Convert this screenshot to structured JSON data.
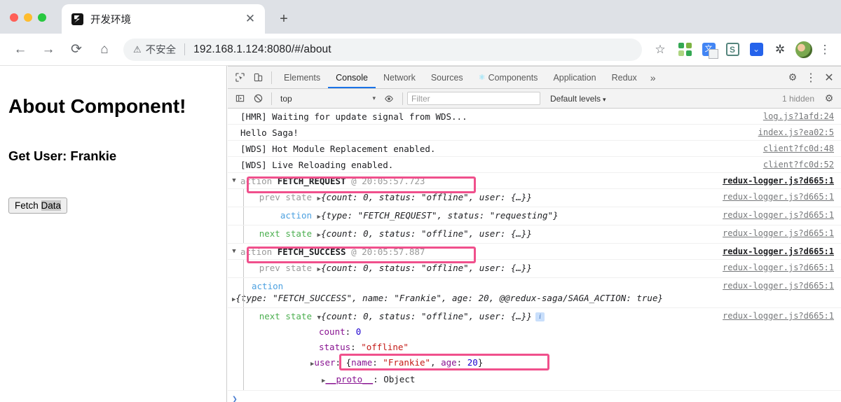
{
  "browser": {
    "tab": {
      "title": "开发环境",
      "close_label": "✕"
    },
    "new_tab_label": "+",
    "nav": {
      "back": "←",
      "forward": "→",
      "reload": "⟳",
      "home": "⌂"
    },
    "omnibox": {
      "security_icon": "warning-triangle-icon",
      "security_text": "不安全",
      "url": "192.168.1.124:8080/#/about"
    },
    "actions": {
      "bookmark": "☆",
      "ext_qr": "qr-code-icon",
      "ext_translate": "文",
      "ext_s": "S",
      "ext_blue": "⌄",
      "ext_puzzle": "✦",
      "avatar": "avatar-icon",
      "menu": "⋮"
    }
  },
  "page": {
    "heading": "About Component!",
    "subheading": "Get User: Frankie",
    "button_prefix": "Fetch ",
    "button_selected": "Data"
  },
  "devtools": {
    "inspect_icon": "inspect-element-icon",
    "device_icon": "device-toolbar-icon",
    "tabs": [
      {
        "label": "Elements",
        "active": false
      },
      {
        "label": "Console",
        "active": true
      },
      {
        "label": "Network",
        "active": false
      },
      {
        "label": "Sources",
        "active": false
      },
      {
        "label": "Components",
        "active": false,
        "react": true
      },
      {
        "label": "Application",
        "active": false
      },
      {
        "label": "Redux",
        "active": false
      }
    ],
    "more_tabs": "»",
    "settings_icon": "⚙",
    "kebab_icon": "⋮",
    "close_icon": "✕",
    "filterbar": {
      "sidebar_icon": "console-sidebar-icon",
      "clear_icon": "🚫",
      "context": "top",
      "context_caret": "▾",
      "eye_icon": "👁",
      "filter_placeholder": "Filter",
      "levels": "Default levels",
      "levels_caret": "▾",
      "hidden": "1 hidden",
      "gear_icon": "⚙"
    },
    "prompt_chevron": "❯"
  },
  "console_rows": [
    {
      "text": "[HMR] Waiting for update signal from WDS...",
      "src": "log.js?1afd:24"
    },
    {
      "text": "Hello Saga!",
      "src": "index.js?ea02:5"
    },
    {
      "text": "[WDS] Hot Module Replacement enabled.",
      "src": "client?fc0d:48"
    },
    {
      "text": "[WDS] Live Reloading enabled.",
      "src": "client?fc0d:52"
    }
  ],
  "groups": [
    {
      "triangle": "▼",
      "header": {
        "label": "action",
        "name": "FETCH_REQUEST",
        "at": "@",
        "time": "20:05:57.723"
      },
      "src": "redux-logger.js?d665:1",
      "rows": [
        {
          "label": "prev state",
          "label_kind": "prev",
          "triangle": "▶",
          "preview": "{count: 0, status: \"offline\", user: {…}}",
          "src": "redux-logger.js?d665:1"
        },
        {
          "label": "action",
          "label_kind": "action",
          "triangle": "▶",
          "preview": "{type: \"FETCH_REQUEST\", status: \"requesting\"}",
          "src": "redux-logger.js?d665:1"
        },
        {
          "label": "next state",
          "label_kind": "next",
          "triangle": "▶",
          "preview": "{count: 0, status: \"offline\", user: {…}}",
          "src": "redux-logger.js?d665:1"
        }
      ]
    },
    {
      "triangle": "▼",
      "header": {
        "label": "action",
        "name": "FETCH_SUCCESS",
        "at": "@",
        "time": "20:05:57.887"
      },
      "src": "redux-logger.js?d665:1",
      "rows": [
        {
          "label": "prev state",
          "label_kind": "prev",
          "triangle": "▶",
          "preview": "{count: 0, status: \"offline\", user: {…}}",
          "src": "redux-logger.js?d665:1"
        },
        {
          "label": "action",
          "label_kind": "action",
          "triangle": "▶",
          "preview": "{type: \"FETCH_SUCCESS\", name: \"Frankie\", age: 20, @@redux-saga/SAGA_ACTION: true}",
          "src": "redux-logger.js?d665:1",
          "wrapped": true
        },
        {
          "label": "next state",
          "label_kind": "next",
          "triangle": "▼",
          "preview": "{count: 0, status: \"offline\", user: {…}}",
          "src": "redux-logger.js?d665:1",
          "expanded": true,
          "children": [
            {
              "key": "count",
              "value": "0",
              "kind": "num"
            },
            {
              "key": "status",
              "value": "\"offline\"",
              "kind": "str"
            },
            {
              "key": "user",
              "value": "{name: \"Frankie\", age: 20}",
              "kind": "obj",
              "triangle": "▶",
              "highlighted": true
            },
            {
              "key": "__proto__",
              "value": "Object",
              "kind": "proto",
              "triangle": "▶"
            }
          ]
        }
      ]
    }
  ],
  "colors": {
    "highlight": "#f0508c",
    "accent_tab": "#1a73e8",
    "label_prev": "#999999",
    "label_action": "#4da1e0",
    "label_next": "#4caf50",
    "string": "#c41a16",
    "number": "#1c00cf",
    "property": "#881391"
  }
}
